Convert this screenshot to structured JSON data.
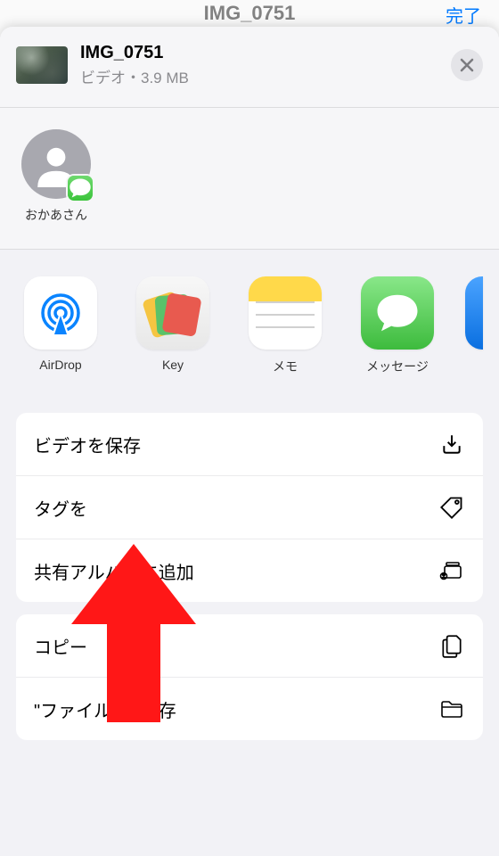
{
  "background": {
    "title": "IMG_0751",
    "done": "完了"
  },
  "header": {
    "title": "IMG_0751",
    "subtitle": "ビデオ・3.9 MB"
  },
  "contacts": [
    {
      "name": "おかあさん"
    }
  ],
  "apps": [
    {
      "label": "AirDrop"
    },
    {
      "label": "Key"
    },
    {
      "label": "メモ"
    },
    {
      "label": "メッセージ"
    }
  ],
  "actions_group1": [
    {
      "label": "ビデオを保存",
      "icon": "download"
    },
    {
      "label": "タグを",
      "icon": "tag"
    },
    {
      "label": "共有アルバムに追加",
      "icon": "shared-album"
    }
  ],
  "actions_group2": [
    {
      "label": "コピー",
      "icon": "copy"
    },
    {
      "label": "\"ファイル\" に保存",
      "icon": "folder"
    }
  ]
}
